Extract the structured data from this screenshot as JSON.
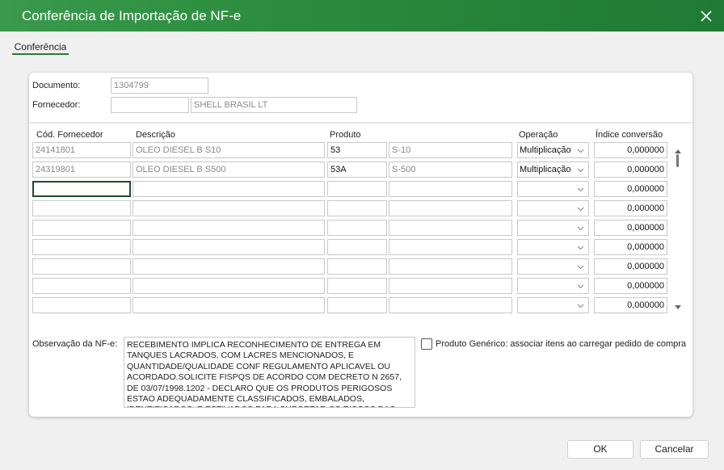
{
  "window": {
    "title": "Conferência de Importação de NF-e"
  },
  "tabs": [
    {
      "label": "Conferência"
    }
  ],
  "header": {
    "documento_label": "Documento:",
    "documento_value": "1304799",
    "fornecedor_label": "Fornecedor:",
    "fornecedor_code": "",
    "fornecedor_name": "SHELL BRASIL LT"
  },
  "grid": {
    "columns": [
      "Cód. Fornecedor",
      "Descrição",
      "Produto",
      "Operação",
      "Índice conversão"
    ],
    "rows": [
      {
        "cod_fornecedor": "24141801",
        "descricao": "OLEO DIESEL B S10",
        "produto": "53",
        "produto_desc": "S-10",
        "operacao": "Multiplicação",
        "indice": "0,000000"
      },
      {
        "cod_fornecedor": "24319801",
        "descricao": "OLEO DIESEL B S500",
        "produto": "53A",
        "produto_desc": "S-500",
        "operacao": "Multiplicação",
        "indice": "0,000000"
      },
      {
        "cod_fornecedor": "",
        "descricao": "",
        "produto": "",
        "produto_desc": "",
        "operacao": "",
        "indice": "0,000000"
      },
      {
        "cod_fornecedor": "",
        "descricao": "",
        "produto": "",
        "produto_desc": "",
        "operacao": "",
        "indice": "0,000000"
      },
      {
        "cod_fornecedor": "",
        "descricao": "",
        "produto": "",
        "produto_desc": "",
        "operacao": "",
        "indice": "0,000000"
      },
      {
        "cod_fornecedor": "",
        "descricao": "",
        "produto": "",
        "produto_desc": "",
        "operacao": "",
        "indice": "0,000000"
      },
      {
        "cod_fornecedor": "",
        "descricao": "",
        "produto": "",
        "produto_desc": "",
        "operacao": "",
        "indice": "0,000000"
      },
      {
        "cod_fornecedor": "",
        "descricao": "",
        "produto": "",
        "produto_desc": "",
        "operacao": "",
        "indice": "0,000000"
      },
      {
        "cod_fornecedor": "",
        "descricao": "",
        "produto": "",
        "produto_desc": "",
        "operacao": "",
        "indice": "0,000000"
      }
    ]
  },
  "observacao": {
    "label": "Observação da NF-e:",
    "text": "RECEBIMENTO IMPLICA RECONHECIMENTO DE ENTREGA EM TANQUES LACRADOS, COM LACRES MENCIONADOS, E QUANTIDADE/QUALIDADE CONF REGULAMENTO APLICAVEL OU ACORDADO.SOLICITE FISPQS DE ACORDO COM DECRETO N 2657, DE 03/07/1998.1202 - DECLARO QUE OS PRODUTOS PERIGOSOS ESTAO ADEQUADAMENTE CLASSIFICADOS, EMBALADOS, IDENTIFICADOS, E ESTIVADOS PARA SUPORTAR OS RISCOS DAS OPERACOES DE TRANSPORTE E QUE ATENDEM AS"
  },
  "produto_generico": {
    "label": "Produto Genérico: associar itens ao carregar pedido de compra",
    "checked": false
  },
  "buttons": {
    "ok": "OK",
    "cancel": "Cancelar"
  },
  "icons": {
    "close": "close-icon",
    "chevron": "chevron-down-icon",
    "scroll_up": "scroll-up-icon",
    "scroll_down": "scroll-down-icon"
  }
}
